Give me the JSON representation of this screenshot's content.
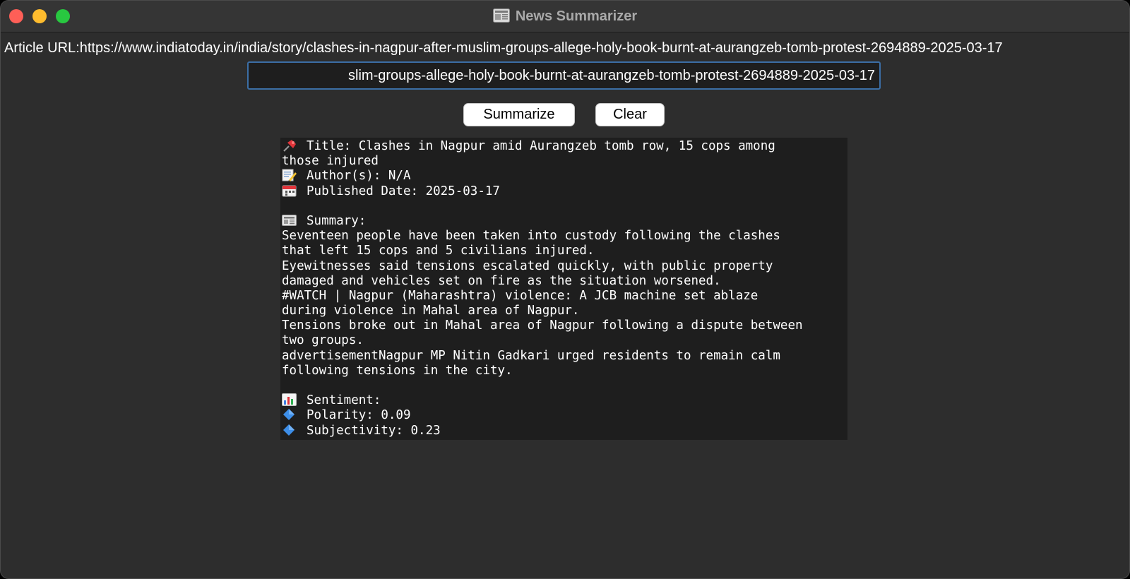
{
  "window": {
    "title": "News Summarizer",
    "title_icon": "newspaper-icon"
  },
  "url_row": {
    "label": "Article URL:",
    "url_text": "https://www.indiatoday.in/india/story/clashes-in-nagpur-after-muslim-groups-allege-holy-book-burnt-at-aurangzeb-tomb-protest-2694889-2025-03-17"
  },
  "url_input": {
    "value": "slim-groups-allege-holy-book-burnt-at-aurangzeb-tomb-protest-2694889-2025-03-17"
  },
  "buttons": {
    "summarize_label": "Summarize",
    "clear_label": "Clear"
  },
  "output": {
    "title_line": "Title: Clashes in Nagpur amid Aurangzeb tomb row, 15 cops among",
    "title_line_cont": "those injured",
    "author_line": "Author(s): N/A",
    "date_line": "Published Date: 2025-03-17",
    "summary_heading": "Summary:",
    "summary_lines": [
      "Seventeen people have been taken into custody following the clashes",
      "that left 15 cops and 5 civilians injured.",
      "Eyewitnesses said tensions escalated quickly, with public property",
      "damaged and vehicles set on fire as the situation worsened.",
      "#WATCH | Nagpur (Maharashtra) violence: A JCB machine set ablaze",
      "during violence in Mahal area of Nagpur.",
      "Tensions broke out in Mahal area of Nagpur following a dispute between",
      "two groups.",
      "advertisementNagpur MP Nitin Gadkari urged residents to remain calm",
      "following tensions in the city."
    ],
    "sentiment_heading": "Sentiment:",
    "polarity_line": "Polarity: 0.09",
    "subjectivity_line": "Subjectivity: 0.23",
    "icons": {
      "title": "pushpin-icon",
      "author": "memo-icon",
      "date": "calendar-icon",
      "summary": "newspaper-icon",
      "sentiment": "bar-chart-icon",
      "bullet": "blue-diamond-icon"
    }
  },
  "colors": {
    "window_bg": "#2d2d2d",
    "titlebar_bg": "#353535",
    "output_bg": "#1e1e1e",
    "input_focus_border": "#3b6ea5",
    "close": "#fe5f57",
    "minimize": "#febc2e",
    "zoom": "#28c840"
  }
}
